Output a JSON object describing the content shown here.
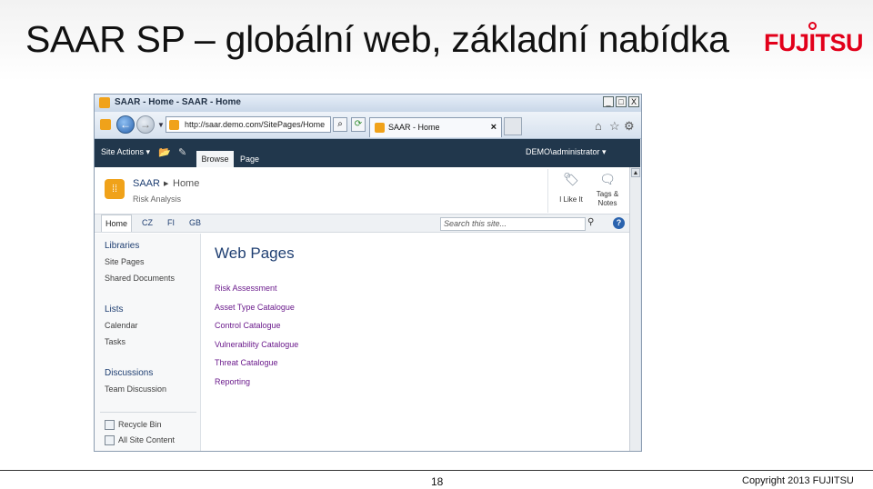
{
  "slide": {
    "title": "SAAR SP – globální web, základní nabídka",
    "logo_text": "FUJITSU",
    "page_number": "18",
    "copyright": "Copyright 2013 FUJITSU"
  },
  "browser": {
    "window_title": "SAAR - Home - SAAR - Home",
    "minimize": "_",
    "maximize": "□",
    "close": "X",
    "address": "http://saar.demo.com/SitePages/Home",
    "tab_title": "SAAR - Home",
    "tab_close": "×",
    "back_glyph": "←",
    "forward_glyph": "→"
  },
  "ribbon": {
    "site_actions": "Site Actions ▾",
    "tab_browse": "Browse",
    "tab_page": "Page",
    "user": "DEMO\\administrator ▾"
  },
  "site": {
    "name": "SAAR",
    "page": "Home",
    "subtitle": "Risk Analysis",
    "i_like_it": "I Like It",
    "tags_notes_1": "Tags &",
    "tags_notes_2": "Notes"
  },
  "topnav": {
    "items": [
      "Home",
      "CZ",
      "FI",
      "GB"
    ],
    "search_placeholder": "Search this site...",
    "help": "?"
  },
  "quicklaunch": {
    "libraries": "Libraries",
    "site_pages": "Site Pages",
    "shared_documents": "Shared Documents",
    "lists": "Lists",
    "calendar": "Calendar",
    "tasks": "Tasks",
    "discussions": "Discussions",
    "team_discussion": "Team Discussion",
    "recycle_bin": "Recycle Bin",
    "all_site_content": "All Site Content"
  },
  "main": {
    "title": "Web Pages",
    "links": [
      "Risk Assessment",
      "Asset Type Catalogue",
      "Control Catalogue",
      "Vulnerability Catalogue",
      "Threat Catalogue",
      "Reporting"
    ]
  },
  "colors": {
    "ribbon_bg": "#21374c",
    "link_visited": "#6b1b8c",
    "heading_blue": "#1f3f72",
    "brand_red": "#e2001a",
    "sharepoint_orange": "#f0a21a"
  }
}
